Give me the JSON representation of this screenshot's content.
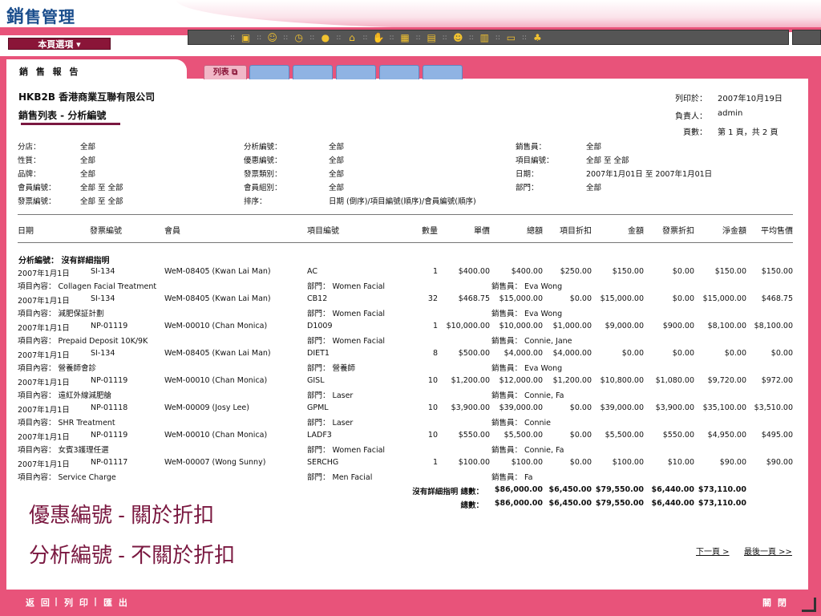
{
  "app": {
    "title_big": "銷",
    "title_rest": "售管理",
    "menu_button": "本頁選項"
  },
  "toolbar": {
    "icons": [
      "box-icon",
      "people-icon",
      "clock-icon",
      "coin-icon",
      "house-icon",
      "hand-icon",
      "calculator-icon",
      "clipboard-icon",
      "group-icon",
      "notebook-icon",
      "monitor-icon",
      "users-icon"
    ]
  },
  "page": {
    "title": "銷 售 報 告",
    "tabs": [
      "列表",
      "",
      "",
      "",
      "",
      ""
    ]
  },
  "report": {
    "company": "HKB2B 香港商業互聯有限公司",
    "title": "銷售列表 - 分析編號",
    "print_label": "列印於：",
    "print_date": "2007年10月19日",
    "owner_label": "負責人：",
    "owner": "admin",
    "page_label": "頁數：",
    "page_info": "第 1 頁，共 2 頁"
  },
  "filters": {
    "col1": [
      [
        "分店：",
        "全部"
      ],
      [
        "性質：",
        "全部"
      ],
      [
        "品牌：",
        "全部"
      ],
      [
        "會員編號：",
        "全部 至 全部"
      ],
      [
        "發票編號：",
        "全部 至 全部"
      ]
    ],
    "col2": [
      [
        "分析編號：",
        "全部"
      ],
      [
        "優惠編號：",
        "全部"
      ],
      [
        "發票類別：",
        "全部"
      ],
      [
        "會員組別：",
        "全部"
      ],
      [
        "排序：",
        "日期 (倒序)/項目編號(順序)/會員編號(順序)"
      ]
    ],
    "col3": [
      [
        "銷售員：",
        "全部"
      ],
      [
        "項目編號：",
        "全部 至 全部"
      ],
      [
        "日期：",
        "2007年1月01日 至 2007年1月01日"
      ],
      [
        "部門：",
        "全部"
      ]
    ]
  },
  "table": {
    "headers": [
      "日期",
      "發票編號",
      "會員",
      "項目編號",
      "數量",
      "單價",
      "總額",
      "項目折扣",
      "金額",
      "發票折扣",
      "淨金額",
      "平均售價"
    ],
    "group_label": "分析編號： 沒有詳細指明",
    "rows": [
      {
        "date": "2007年1月1日",
        "invoice": "SI-134",
        "member": "WeM-08405 (Kwan Lai Man)",
        "item": "AC",
        "qty": "1",
        "price": "$400.00",
        "total": "$400.00",
        "item_disc": "$250.00",
        "amount": "$150.00",
        "inv_disc": "$0.00",
        "net": "$150.00",
        "avg": "$150.00",
        "content": "項目內容： Collagen Facial Treatment",
        "dept": "部門： Women Facial",
        "sales": "銷售員： Eva Wong"
      },
      {
        "date": "2007年1月1日",
        "invoice": "SI-134",
        "member": "WeM-08405 (Kwan Lai Man)",
        "item": "CB12",
        "qty": "32",
        "price": "$468.75",
        "total": "$15,000.00",
        "item_disc": "$0.00",
        "amount": "$15,000.00",
        "inv_disc": "$0.00",
        "net": "$15,000.00",
        "avg": "$468.75",
        "content": "項目內容： 減肥保証計劃",
        "dept": "部門： Women Facial",
        "sales": "銷售員： Eva Wong"
      },
      {
        "date": "2007年1月1日",
        "invoice": "NP-01119",
        "member": "WeM-00010 (Chan Monica)",
        "item": "D1009",
        "qty": "1",
        "price": "$10,000.00",
        "total": "$10,000.00",
        "item_disc": "$1,000.00",
        "amount": "$9,000.00",
        "inv_disc": "$900.00",
        "net": "$8,100.00",
        "avg": "$8,100.00",
        "content": "項目內容： Prepaid Deposit 10K/9K",
        "dept": "部門： Women Facial",
        "sales": "銷售員： Connie, Jane"
      },
      {
        "date": "2007年1月1日",
        "invoice": "SI-134",
        "member": "WeM-08405 (Kwan Lai Man)",
        "item": "DIET1",
        "qty": "8",
        "price": "$500.00",
        "total": "$4,000.00",
        "item_disc": "$4,000.00",
        "amount": "$0.00",
        "inv_disc": "$0.00",
        "net": "$0.00",
        "avg": "$0.00",
        "content": "項目內容： 營養師會診",
        "dept": "部門： 營養師",
        "sales": "銷售員： Eva Wong"
      },
      {
        "date": "2007年1月1日",
        "invoice": "NP-01119",
        "member": "WeM-00010 (Chan Monica)",
        "item": "GISL",
        "qty": "10",
        "price": "$1,200.00",
        "total": "$12,000.00",
        "item_disc": "$1,200.00",
        "amount": "$10,800.00",
        "inv_disc": "$1,080.00",
        "net": "$9,720.00",
        "avg": "$972.00",
        "content": "項目內容： 遠紅外線減肥艙",
        "dept": "部門： Laser",
        "sales": "銷售員： Connie, Fa"
      },
      {
        "date": "2007年1月1日",
        "invoice": "NP-01118",
        "member": "WeM-00009 (Josy Lee)",
        "item": "GPML",
        "qty": "10",
        "price": "$3,900.00",
        "total": "$39,000.00",
        "item_disc": "$0.00",
        "amount": "$39,000.00",
        "inv_disc": "$3,900.00",
        "net": "$35,100.00",
        "avg": "$3,510.00",
        "content": "項目內容： SHR Treatment",
        "dept": "部門： Laser",
        "sales": "銷售員： Connie"
      },
      {
        "date": "2007年1月1日",
        "invoice": "NP-01119",
        "member": "WeM-00010 (Chan Monica)",
        "item": "LADF3",
        "qty": "10",
        "price": "$550.00",
        "total": "$5,500.00",
        "item_disc": "$0.00",
        "amount": "$5,500.00",
        "inv_disc": "$550.00",
        "net": "$4,950.00",
        "avg": "$495.00",
        "content": "項目內容： 女賓3護理任選",
        "dept": "部門： Women Facial",
        "sales": "銷售員： Connie, Fa"
      },
      {
        "date": "2007年1月1日",
        "invoice": "NP-01117",
        "member": "WeM-00007 (Wong Sunny)",
        "item": "SERCHG",
        "qty": "1",
        "price": "$100.00",
        "total": "$100.00",
        "item_disc": "$0.00",
        "amount": "$100.00",
        "inv_disc": "$10.00",
        "net": "$90.00",
        "avg": "$90.00",
        "content": "項目內容： Service Charge",
        "dept": "部門： Men Facial",
        "sales": "銷售員： Fa"
      }
    ],
    "subtotal": {
      "label": "沒有詳細指明 總數：",
      "total": "$86,000.00",
      "item_disc": "$6,450.00",
      "amount": "$79,550.00",
      "inv_disc": "$6,440.00",
      "net": "$73,110.00"
    },
    "grandtotal": {
      "label": "總數：",
      "total": "$86,000.00",
      "item_disc": "$6,450.00",
      "amount": "$79,550.00",
      "inv_disc": "$6,440.00",
      "net": "$73,110.00"
    }
  },
  "notes": {
    "line1": "優惠編號 - 關於折扣",
    "line2": "分析編號 - 不關於折扣"
  },
  "pager": {
    "next": "下一頁 >",
    "last": "最後一頁 >>"
  },
  "footer": {
    "back": "返 回",
    "print": "列 印",
    "export": "匯 出",
    "close": "關 閉"
  }
}
